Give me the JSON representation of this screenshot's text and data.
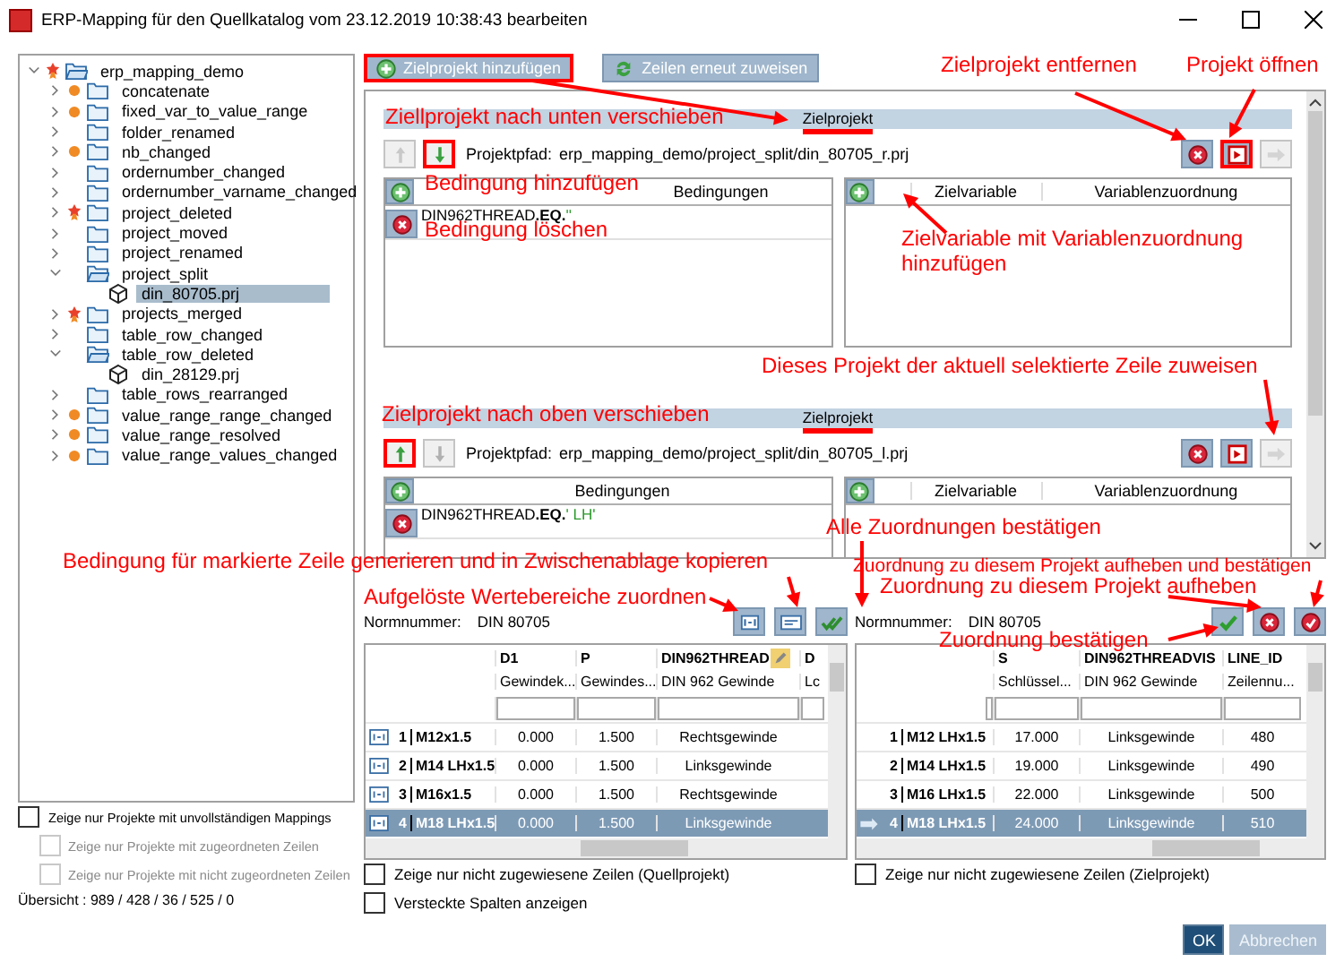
{
  "window": {
    "title": "ERP-Mapping für den Quellkatalog vom 23.12.2019 10:38:43 bearbeiten"
  },
  "tree": [
    {
      "label": "erp_mapping_demo",
      "kind": "folder",
      "changed": false,
      "flagged": true,
      "expanded": true,
      "selected": false,
      "children": [
        {
          "label": "concatenate",
          "kind": "folder",
          "changed": true,
          "flagged": false,
          "expanded": false,
          "selected": false
        },
        {
          "label": "fixed_var_to_value_range",
          "kind": "folder",
          "changed": true,
          "flagged": false,
          "expanded": false,
          "selected": false
        },
        {
          "label": "folder_renamed",
          "kind": "folder",
          "changed": false,
          "flagged": false,
          "expanded": false,
          "selected": false
        },
        {
          "label": "nb_changed",
          "kind": "folder",
          "changed": true,
          "flagged": false,
          "expanded": false,
          "selected": false
        },
        {
          "label": "ordernumber_changed",
          "kind": "folder",
          "changed": false,
          "flagged": false,
          "expanded": false,
          "selected": false
        },
        {
          "label": "ordernumber_varname_changed",
          "kind": "folder",
          "changed": false,
          "flagged": false,
          "expanded": false,
          "selected": false
        },
        {
          "label": "project_deleted",
          "kind": "folder",
          "changed": false,
          "flagged": true,
          "expanded": false,
          "selected": false
        },
        {
          "label": "project_moved",
          "kind": "folder",
          "changed": false,
          "flagged": false,
          "expanded": false,
          "selected": false
        },
        {
          "label": "project_renamed",
          "kind": "folder",
          "changed": false,
          "flagged": false,
          "expanded": false,
          "selected": false
        },
        {
          "label": "project_split",
          "kind": "folder",
          "changed": false,
          "flagged": false,
          "expanded": true,
          "selected": false,
          "children": [
            {
              "label": "din_80705.prj",
              "kind": "project",
              "changed": false,
              "flagged": false,
              "selected": true
            }
          ]
        },
        {
          "label": "projects_merged",
          "kind": "folder",
          "changed": false,
          "flagged": true,
          "expanded": false,
          "selected": false
        },
        {
          "label": "table_row_changed",
          "kind": "folder",
          "changed": false,
          "flagged": false,
          "expanded": false,
          "selected": false
        },
        {
          "label": "table_row_deleted",
          "kind": "folder",
          "changed": false,
          "flagged": false,
          "expanded": true,
          "selected": false,
          "children": [
            {
              "label": "din_28129.prj",
              "kind": "project",
              "changed": false,
              "flagged": false,
              "selected": false
            }
          ]
        },
        {
          "label": "table_rows_rearranged",
          "kind": "folder",
          "changed": false,
          "flagged": false,
          "expanded": false,
          "selected": false
        },
        {
          "label": "value_range_range_changed",
          "kind": "folder",
          "changed": true,
          "flagged": false,
          "expanded": false,
          "selected": false
        },
        {
          "label": "value_range_resolved",
          "kind": "folder",
          "changed": true,
          "flagged": false,
          "expanded": false,
          "selected": false
        },
        {
          "label": "value_range_values_changed",
          "kind": "folder",
          "changed": true,
          "flagged": false,
          "expanded": false,
          "selected": false
        }
      ]
    }
  ],
  "left_options": [
    {
      "label": "Zeige nur Projekte mit unvollständigen Mappings",
      "checked": false,
      "disabled": false
    },
    {
      "label": "Zeige nur Projekte mit zugeordneten Zeilen",
      "checked": false,
      "disabled": true
    },
    {
      "label": "Zeige nur Projekte mit nicht zugeordneten Zeilen",
      "checked": false,
      "disabled": true
    }
  ],
  "overview": "Übersicht : 989 / 428 / 36 / 525 / 0",
  "toolbar": [
    {
      "label": "Zielprojekt hinzufügen",
      "kind": "add",
      "highlighted": true
    },
    {
      "label": "Zeilen erneut zuweisen",
      "kind": "refresh",
      "highlighted": false
    }
  ],
  "target_projects": [
    {
      "title": "Zielprojekt",
      "title_marked": true,
      "path_label": "Projektpfad:",
      "path": "erp_mapping_demo/project_split/din_80705_r.prj",
      "up": {
        "disabled": true,
        "highlighted": false
      },
      "down": {
        "disabled": false,
        "highlighted": true
      },
      "open_highlighted": true,
      "conditions_header": "Bedingungen",
      "conditions": [
        {
          "variable": "DIN962THREAD",
          "operator": ".EQ.",
          "value": "''"
        }
      ],
      "variable_headers": [
        "Zielvariable",
        "Variablenzuordnung"
      ]
    },
    {
      "title": "Zielprojekt",
      "title_marked": true,
      "path_label": "Projektpfad:",
      "path": "erp_mapping_demo/project_split/din_80705_l.prj",
      "up": {
        "disabled": false,
        "highlighted": true
      },
      "down": {
        "disabled": true,
        "highlighted": false
      },
      "open_highlighted": false,
      "conditions_header": "Bedingungen",
      "conditions": [
        {
          "variable": "DIN962THREAD",
          "operator": ".EQ.",
          "value": "' LH'"
        }
      ],
      "variable_headers": [
        "Zielvariable",
        "Variablenzuordnung"
      ]
    }
  ],
  "source": {
    "norm_label": "Normnummer:",
    "norm_value": "DIN 80705",
    "columns": [
      {
        "name": "D1",
        "description": "Gewindek..."
      },
      {
        "name": "P",
        "description": "Gewindes..."
      },
      {
        "name": "DIN962THREAD",
        "description": "DIN 962 Gewinde",
        "editable": true
      },
      {
        "name": "D",
        "description": "Lc",
        "editable": false
      }
    ],
    "rows": [
      {
        "index": "1",
        "name": "M12x1.5",
        "cells": [
          "0.000",
          "1.500",
          "Rechtsgewinde"
        ],
        "selected": false
      },
      {
        "index": "2",
        "name": "M14 LHx1.5",
        "cells": [
          "0.000",
          "1.500",
          "Linksgewinde"
        ],
        "selected": false
      },
      {
        "index": "3",
        "name": "M16x1.5",
        "cells": [
          "0.000",
          "1.500",
          "Rechtsgewinde"
        ],
        "selected": false
      },
      {
        "index": "4",
        "name": "M18 LHx1.5",
        "cells": [
          "0.000",
          "1.500",
          "Linksgewinde"
        ],
        "selected": true
      }
    ],
    "options": [
      {
        "label": "Zeige nur nicht zugewiesene Zeilen (Quellprojekt)",
        "checked": false
      },
      {
        "label": "Versteckte Spalten anzeigen",
        "checked": false
      }
    ]
  },
  "target": {
    "norm_label": "Normnummer:",
    "norm_value": "DIN 80705",
    "columns": [
      {
        "name": "S",
        "description": "Schlüssel..."
      },
      {
        "name": "DIN962THREADVIS",
        "description": "DIN 962 Gewinde"
      },
      {
        "name": "LINE_ID",
        "description": "Zeilennu..."
      }
    ],
    "rows": [
      {
        "index": "1",
        "name": "M12 LHx1.5",
        "cells": [
          "17.000",
          "Linksgewinde",
          "480"
        ],
        "selected": false,
        "assigned": false
      },
      {
        "index": "2",
        "name": "M14 LHx1.5",
        "cells": [
          "19.000",
          "Linksgewinde",
          "490"
        ],
        "selected": false,
        "assigned": false
      },
      {
        "index": "3",
        "name": "M16 LHx1.5",
        "cells": [
          "22.000",
          "Linksgewinde",
          "500"
        ],
        "selected": false,
        "assigned": false
      },
      {
        "index": "4",
        "name": "M18 LHx1.5",
        "cells": [
          "24.000",
          "Linksgewinde",
          "510"
        ],
        "selected": true,
        "assigned": true
      }
    ],
    "options": [
      {
        "label": "Zeige nur nicht zugewiesene Zeilen (Zielprojekt)",
        "checked": false
      }
    ]
  },
  "buttons": [
    {
      "label": "OK",
      "kind": "primary"
    },
    {
      "label": "Abbrechen",
      "kind": "disabled"
    }
  ],
  "annotations": [
    "Zielprojekt entfernen",
    "Projekt öffnen",
    "Ziellprojekt nach unten verschieben",
    "Bedingung hinzufügen",
    "Bedingung löschen",
    "Zielvariable mit Variablenzuordnung hinzufügen",
    "Dieses Projekt der aktuell selektierte Zeile zuweisen",
    "Zielprojekt nach oben verschieben",
    "Alle Zuordnungen bestätigen",
    "Bedingung für markierte Zeile generieren und in Zwischenablage kopieren",
    "Zuordnung zu diesem Projekt aufheben und bestätigen",
    "Zuordnung zu diesem Projekt aufheben",
    "Aufgelöste Wertebereiche zuordnen",
    "Zuordnung bestätigen"
  ]
}
